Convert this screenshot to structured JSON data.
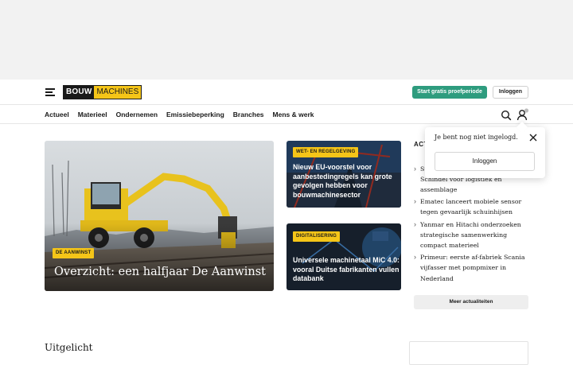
{
  "header": {
    "logo_part1": "BOUW",
    "logo_part2": "MACHINES",
    "trial_button": "Start gratis proefperiode",
    "login_button": "Inloggen"
  },
  "nav": {
    "items": [
      "Actueel",
      "Materieel",
      "Ondernemen",
      "Emissiebeperking",
      "Branches",
      "Mens & werk"
    ]
  },
  "hero": {
    "tag": "DE AANWINST",
    "title": "Overzicht: een halfjaar De Aanwinst"
  },
  "cards": [
    {
      "tag": "WET- EN REGELGEVING",
      "title": "Nieuw EU-voorstel voor aanbestedingregels kan grote gevolgen hebben voor bouwmachinesector"
    },
    {
      "tag": "DIGITALISERING",
      "title": "Universele machinetaal MiC 4.0: vooral Duitse fabrikanten vullen databank"
    }
  ],
  "aside": {
    "heading": "ACT",
    "first_item_partial": "Schindel voor logistiek en assemblage",
    "first_item_lead": "St",
    "items": [
      "Ematec lanceert mobiele sensor tegen gevaarlijk schuinhijsen",
      "Yanmar en Hitachi onderzoeken strategische samenwerking compact materieel",
      "Primeur: eerste af-fabriek Scania vijfasser met pompmixer in Nederland"
    ],
    "more_button": "Meer actualiteiten"
  },
  "featured": {
    "title": "Uitgelicht"
  },
  "popover": {
    "text": "Je bent nog niet ingelogd.",
    "login_button": "Inloggen"
  },
  "colors": {
    "accent_yellow": "#f5c518",
    "trial_green": "#2e9c7e"
  }
}
